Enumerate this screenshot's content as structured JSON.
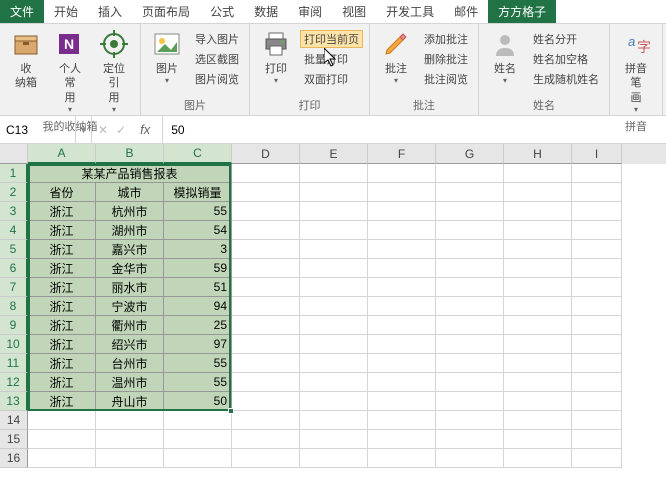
{
  "tabs": [
    "文件",
    "开始",
    "插入",
    "页面布局",
    "公式",
    "数据",
    "审阅",
    "视图",
    "开发工具",
    "邮件",
    "方方格子"
  ],
  "ribbon": {
    "group1": {
      "btn1": "收\n纳箱",
      "btn2": "个人常\n用",
      "btn3": "定位引\n用",
      "label": "我的收纳箱"
    },
    "group2": {
      "btn1": "图片",
      "items": [
        "导入图片",
        "选区截图",
        "图片阅览"
      ],
      "label": "图片"
    },
    "group3": {
      "btn1": "打印",
      "items": [
        "打印当前页",
        "批量打印",
        "双面打印"
      ],
      "label": "打印"
    },
    "group4": {
      "btn1": "批注",
      "items": [
        "添加批注",
        "删除批注",
        "批注阅览"
      ],
      "label": "批注"
    },
    "group5": {
      "btn1": "姓名",
      "items": [
        "姓名分开",
        "姓名加空格",
        "生成随机姓名"
      ],
      "label": "姓名"
    },
    "group6": {
      "btn1": "拼音笔\n画",
      "label": "拼音"
    }
  },
  "nameBox": "C13",
  "formulaValue": "50",
  "columns": [
    "A",
    "B",
    "C",
    "D",
    "E",
    "F",
    "G",
    "H",
    "I"
  ],
  "rowCount": 16,
  "titleRow": "某某产品销售报表",
  "headers": [
    "省份",
    "城市",
    "模拟销量"
  ],
  "data": [
    [
      "浙江",
      "杭州市",
      "55"
    ],
    [
      "浙江",
      "湖州市",
      "54"
    ],
    [
      "浙江",
      "嘉兴市",
      "3"
    ],
    [
      "浙江",
      "金华市",
      "59"
    ],
    [
      "浙江",
      "丽水市",
      "51"
    ],
    [
      "浙江",
      "宁波市",
      "94"
    ],
    [
      "浙江",
      "衢州市",
      "25"
    ],
    [
      "浙江",
      "绍兴市",
      "97"
    ],
    [
      "浙江",
      "台州市",
      "55"
    ],
    [
      "浙江",
      "温州市",
      "55"
    ],
    [
      "浙江",
      "舟山市",
      "50"
    ]
  ],
  "chart_data": {
    "type": "table",
    "title": "某某产品销售报表",
    "columns": [
      "省份",
      "城市",
      "模拟销量"
    ],
    "rows": [
      [
        "浙江",
        "杭州市",
        55
      ],
      [
        "浙江",
        "湖州市",
        54
      ],
      [
        "浙江",
        "嘉兴市",
        3
      ],
      [
        "浙江",
        "金华市",
        59
      ],
      [
        "浙江",
        "丽水市",
        51
      ],
      [
        "浙江",
        "宁波市",
        94
      ],
      [
        "浙江",
        "衢州市",
        25
      ],
      [
        "浙江",
        "绍兴市",
        97
      ],
      [
        "浙江",
        "台州市",
        55
      ],
      [
        "浙江",
        "温州市",
        55
      ],
      [
        "浙江",
        "舟山市",
        50
      ]
    ]
  }
}
